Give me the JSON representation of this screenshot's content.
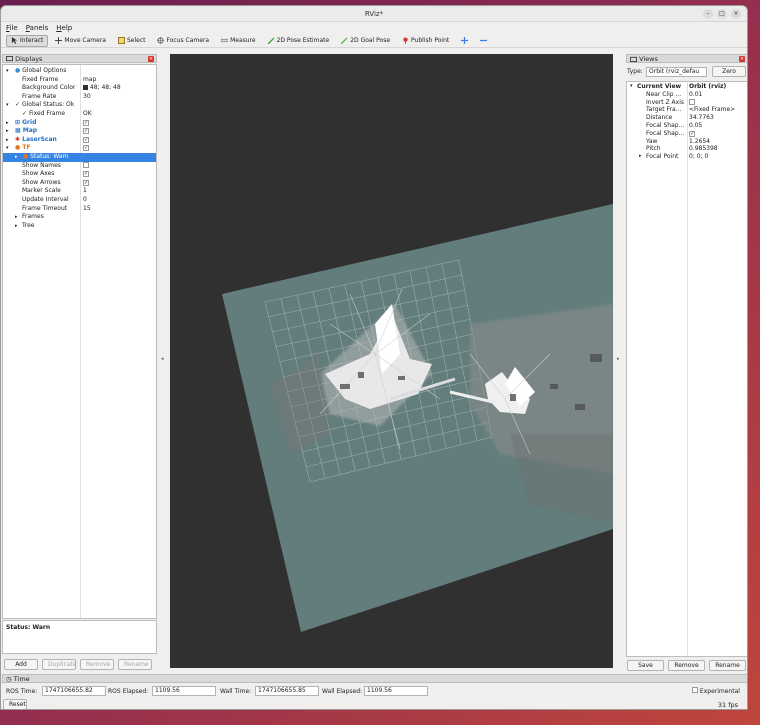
{
  "window": {
    "title": "RViz*"
  },
  "menu": [
    {
      "label": "File",
      "key": "F",
      "rest": "ile"
    },
    {
      "label": "Panels",
      "key": "P",
      "rest": "anels"
    },
    {
      "label": "Help",
      "key": "H",
      "rest": "elp"
    }
  ],
  "toolbar": {
    "interact": "Interact",
    "move_camera": "Move Camera",
    "select": "Select",
    "focus_camera": "Focus Camera",
    "measure": "Measure",
    "pose_estimate": "2D Pose Estimate",
    "goal_pose": "2D Goal Pose",
    "publish_point": "Publish Point"
  },
  "displays": {
    "title": "Displays",
    "rows": [
      {
        "name": "Global Options",
        "value": ""
      },
      {
        "name": "Fixed Frame",
        "value": "map"
      },
      {
        "name": "Background Color",
        "value": "48; 48; 48"
      },
      {
        "name": "Frame Rate",
        "value": "30"
      },
      {
        "name": "Global Status: Ok",
        "value": ""
      },
      {
        "name": "Fixed Frame",
        "value": "OK"
      },
      {
        "name": "Grid",
        "value": ""
      },
      {
        "name": "Map",
        "value": ""
      },
      {
        "name": "LaserScan",
        "value": ""
      },
      {
        "name": "TF",
        "value": ""
      },
      {
        "name": "Status: Warn",
        "value": ""
      },
      {
        "name": "Show Names",
        "value": ""
      },
      {
        "name": "Show Axes",
        "value": ""
      },
      {
        "name": "Show Arrows",
        "value": ""
      },
      {
        "name": "Marker Scale",
        "value": "1"
      },
      {
        "name": "Update Interval",
        "value": "0"
      },
      {
        "name": "Frame Timeout",
        "value": "15"
      },
      {
        "name": "Frames",
        "value": ""
      },
      {
        "name": "Tree",
        "value": ""
      }
    ],
    "status_text": "Status: Warn",
    "buttons": {
      "add": "Add",
      "duplicate": "Duplicate",
      "remove": "Remove",
      "rename": "Rename"
    }
  },
  "views": {
    "title": "Views",
    "type_label": "Type:",
    "type_value": "Orbit (rviz_defau",
    "zero": "Zero",
    "rows": [
      {
        "name": "Current View",
        "value": "Orbit (rviz)"
      },
      {
        "name": "Near Clip ...",
        "value": "0.01"
      },
      {
        "name": "Invert Z Axis",
        "value": ""
      },
      {
        "name": "Target Fra...",
        "value": "<Fixed Frame>"
      },
      {
        "name": "Distance",
        "value": "34.7763"
      },
      {
        "name": "Focal Shap...",
        "value": "0.05"
      },
      {
        "name": "Focal Shap...",
        "value": ""
      },
      {
        "name": "Yaw",
        "value": "1.2654"
      },
      {
        "name": "Pitch",
        "value": "0.985398"
      },
      {
        "name": "Focal Point",
        "value": "0; 0; 0"
      }
    ],
    "buttons": {
      "save": "Save",
      "remove": "Remove",
      "rename": "Rename"
    }
  },
  "time": {
    "title": "Time",
    "ros_time_label": "ROS Time:",
    "ros_time": "1747106655.82",
    "ros_elapsed_label": "ROS Elapsed:",
    "ros_elapsed": "1109.56",
    "wall_time_label": "Wall Time:",
    "wall_time": "1747106655.85",
    "wall_elapsed_label": "Wall Elapsed:",
    "wall_elapsed": "1109.56",
    "experimental": "Experimental",
    "reset": "Reset",
    "fps": "31 fps"
  },
  "colors": {
    "background": "#303030",
    "map_plane": "#607b7a",
    "selection": "#3584e4"
  }
}
